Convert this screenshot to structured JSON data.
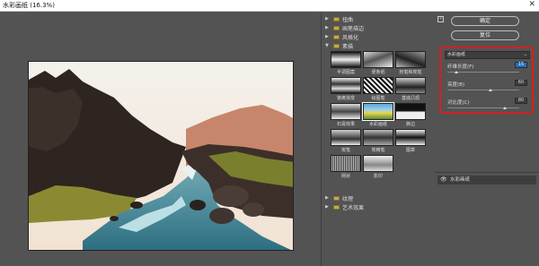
{
  "window": {
    "title": "水彩画纸 (16.3%)",
    "close": "✕"
  },
  "categories": [
    {
      "label": "扭曲",
      "expanded": false
    },
    {
      "label": "画笔描边",
      "expanded": false
    },
    {
      "label": "风格化",
      "expanded": false
    },
    {
      "label": "素描",
      "expanded": true
    },
    {
      "label": "纹理",
      "expanded": false
    },
    {
      "label": "艺术效果",
      "expanded": false
    }
  ],
  "filters": [
    {
      "label": "半调图案"
    },
    {
      "label": "便条纸"
    },
    {
      "label": "粉笔和炭笔"
    },
    {
      "label": "铬黄渐变"
    },
    {
      "label": "绘图笔"
    },
    {
      "label": "基底凸现"
    },
    {
      "label": "石膏效果"
    },
    {
      "label": "水彩画纸",
      "selected": true
    },
    {
      "label": "撕边"
    },
    {
      "label": "炭笔"
    },
    {
      "label": "炭精笔"
    },
    {
      "label": "图章"
    },
    {
      "label": "网状"
    },
    {
      "label": "影印"
    }
  ],
  "buttons": {
    "ok": "确定",
    "reset": "复位",
    "collapse": "«"
  },
  "settings": {
    "selected_filter": "水彩画纸",
    "params": [
      {
        "label": "纤维长度(F)",
        "value": "15",
        "fraction": 0.12,
        "active": true
      },
      {
        "label": "亮度(B)",
        "value": "60",
        "fraction": 0.6,
        "active": false
      },
      {
        "label": "对比度(C)",
        "value": "80",
        "fraction": 0.8,
        "active": false
      }
    ]
  },
  "layers": {
    "row_label": "水彩画纸",
    "eye": "👁"
  },
  "icons": {
    "expanded_arrow": "▼",
    "collapsed_arrow": "▶",
    "folder": "folder-icon",
    "chevron": "⌄"
  }
}
